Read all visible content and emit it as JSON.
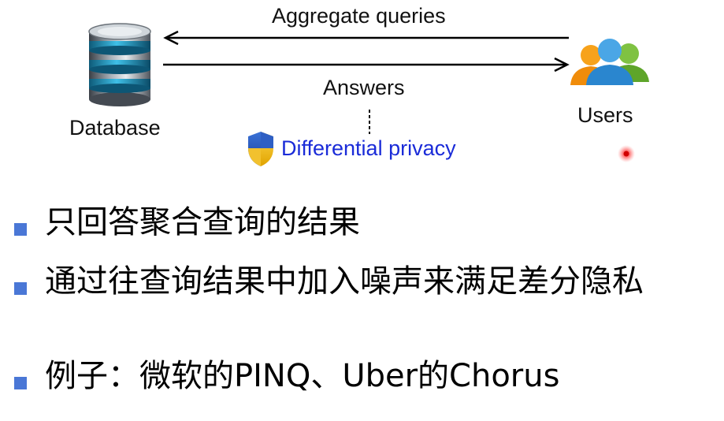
{
  "diagram": {
    "top_arrow_label": "Aggregate queries",
    "bottom_arrow_label": "Answers",
    "database_label": "Database",
    "users_label": "Users",
    "dp_label": "Differential privacy",
    "icons": [
      "database-icon",
      "users-icon",
      "shield-icon"
    ],
    "colors": {
      "dp_text": "#1a2bd8",
      "bullet_marker": "#4a77d6",
      "laser_dot": "#e02020"
    }
  },
  "bullets": [
    {
      "text": "只回答聚合查询的结果"
    },
    {
      "text": "通过往查询结果中加入噪声来满足差分隐私"
    },
    {
      "text": "例子：微软的PINQ、Uber的Chorus"
    }
  ]
}
